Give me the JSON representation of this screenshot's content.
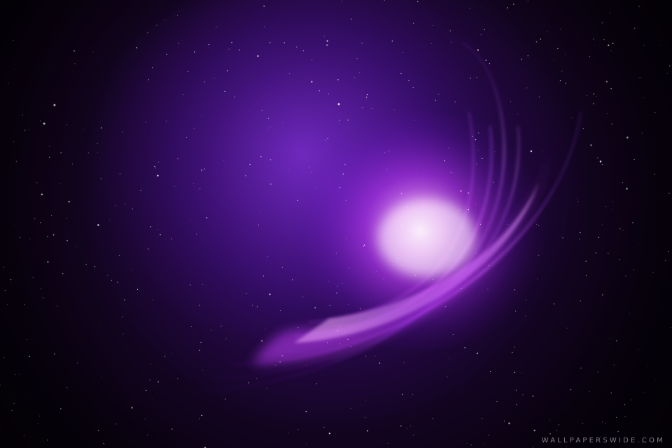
{
  "scene": {
    "description_colors": {
      "background": "#07010d",
      "deep_purple": "#3a0a6b",
      "glow_magenta": "#d24cff",
      "glow_core": "#fbe6ff"
    },
    "watermark": "WALLPAPERSWIDE.COM"
  }
}
